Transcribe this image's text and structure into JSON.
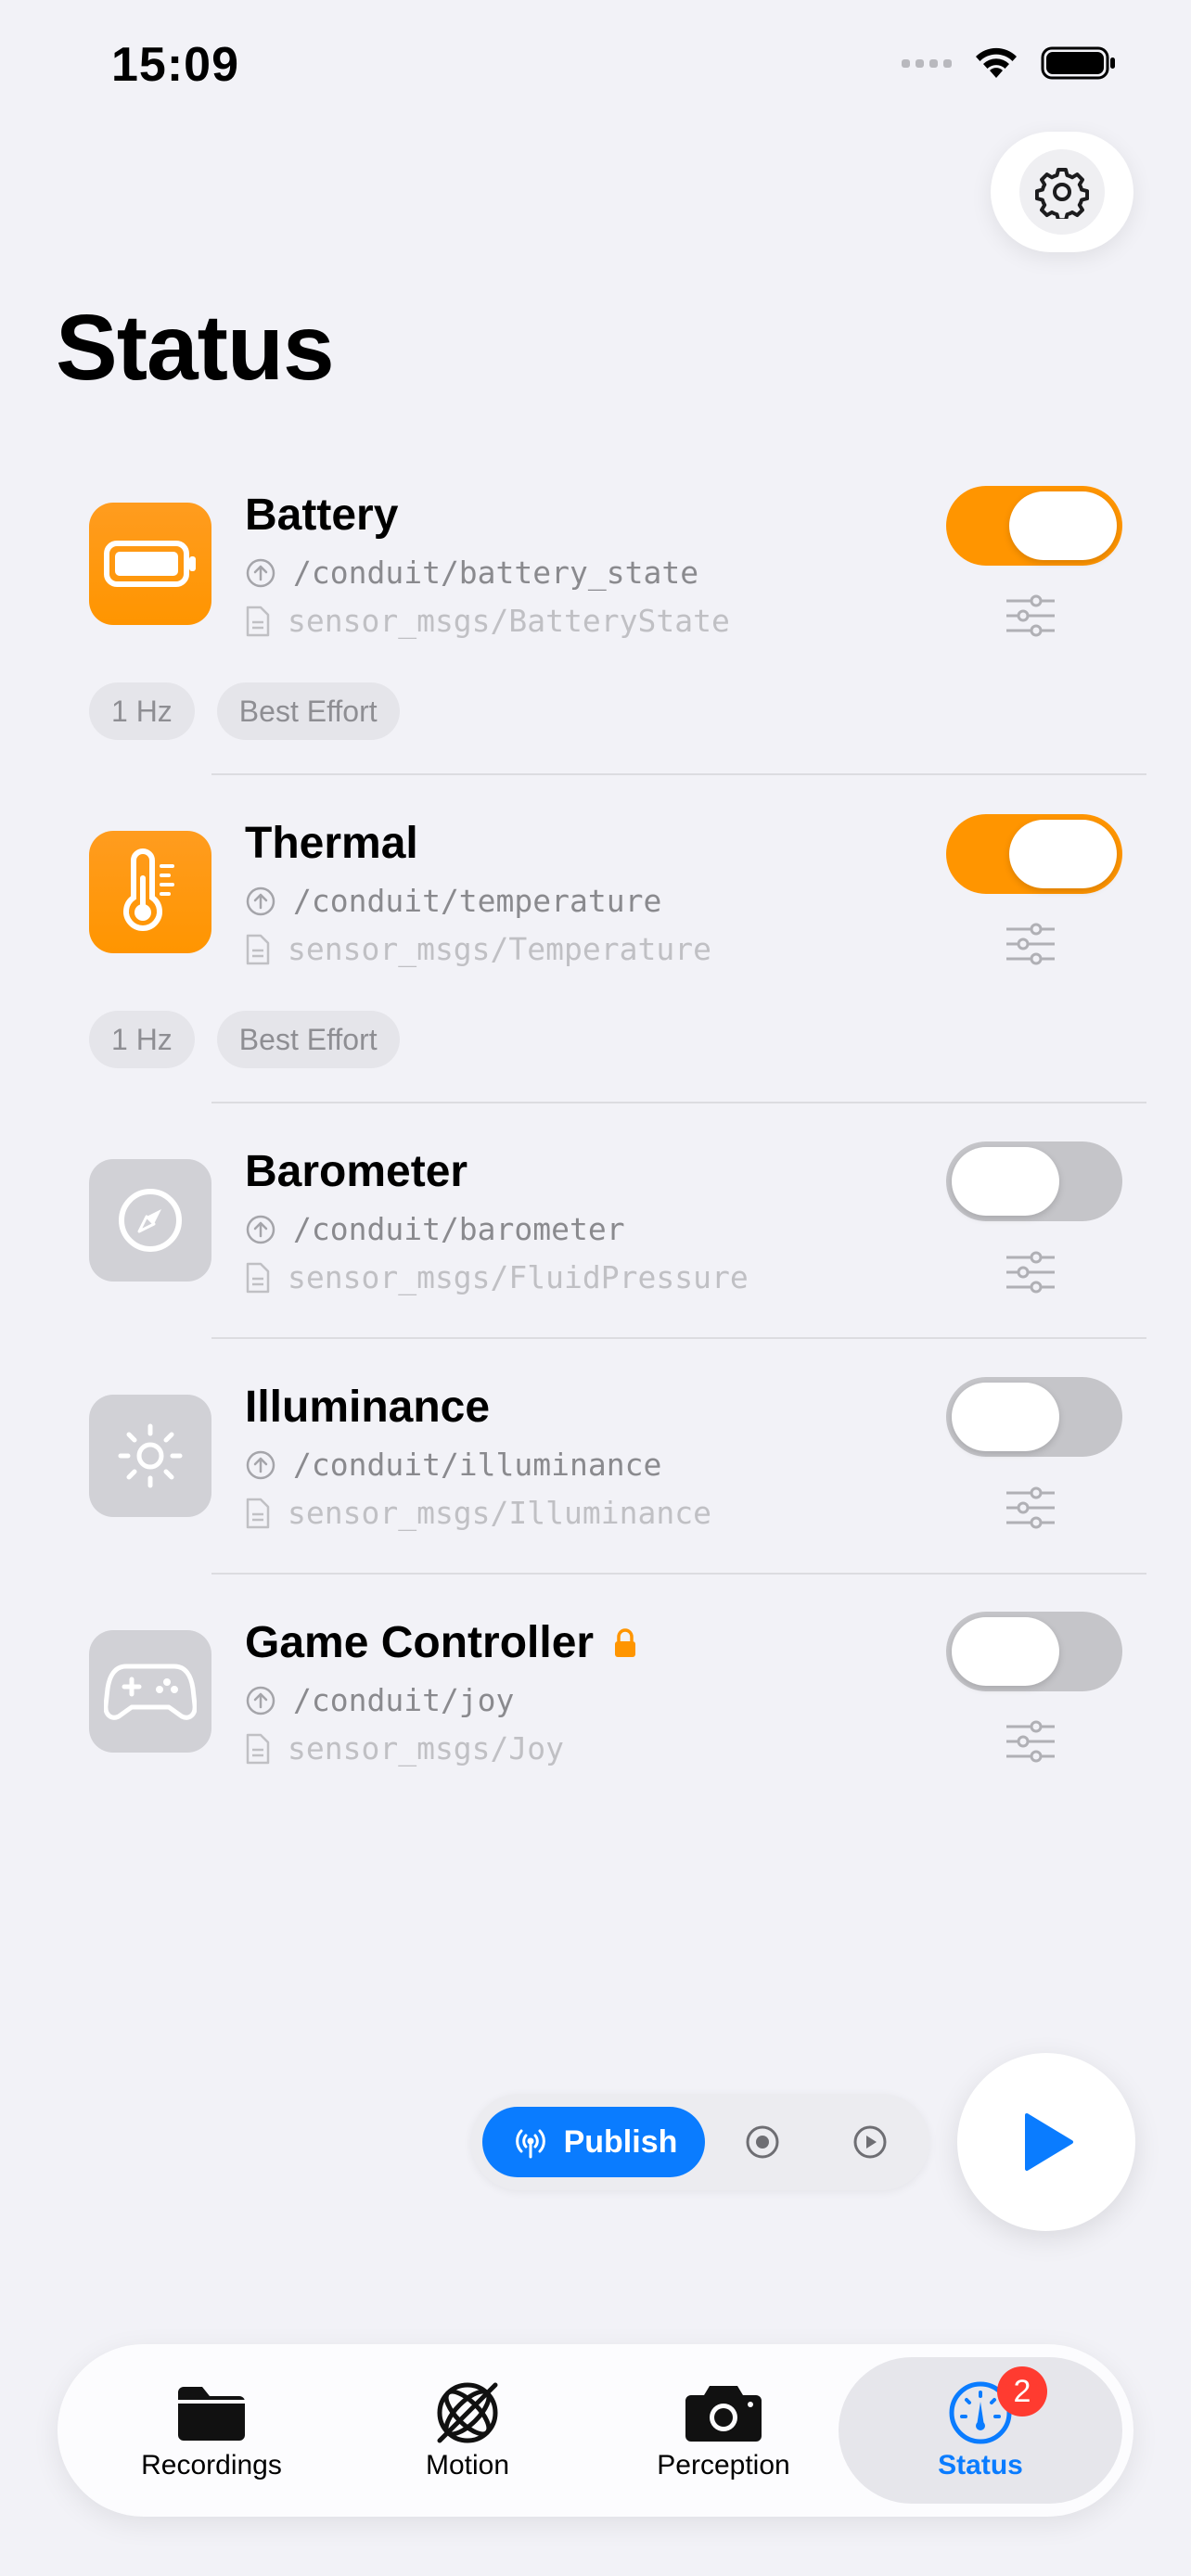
{
  "status_bar": {
    "time": "15:09"
  },
  "page": {
    "title": "Status"
  },
  "sensors": [
    {
      "name": "Battery",
      "topic": "/conduit/battery_state",
      "msg_type": "sensor_msgs/BatteryState",
      "enabled": true,
      "icon": "battery-icon",
      "chips": [
        "1 Hz",
        "Best Effort"
      ]
    },
    {
      "name": "Thermal",
      "topic": "/conduit/temperature",
      "msg_type": "sensor_msgs/Temperature",
      "enabled": true,
      "icon": "thermometer-icon",
      "chips": [
        "1 Hz",
        "Best Effort"
      ]
    },
    {
      "name": "Barometer",
      "topic": "/conduit/barometer",
      "msg_type": "sensor_msgs/FluidPressure",
      "enabled": false,
      "icon": "gauge-icon"
    },
    {
      "name": "Illuminance",
      "topic": "/conduit/illuminance",
      "msg_type": "sensor_msgs/Illuminance",
      "enabled": false,
      "icon": "sun-icon"
    },
    {
      "name": "Game Controller",
      "topic": "/conduit/joy",
      "msg_type": "sensor_msgs/Joy",
      "enabled": false,
      "icon": "gamepad-icon",
      "locked": true
    }
  ],
  "mode_bar": {
    "publish_label": "Publish",
    "selected": "publish"
  },
  "tabs": [
    {
      "label": "Recordings",
      "icon": "folder-icon"
    },
    {
      "label": "Motion",
      "icon": "gyroscope-icon"
    },
    {
      "label": "Perception",
      "icon": "camera-icon"
    },
    {
      "label": "Status",
      "icon": "gauge-icon",
      "badge": "2",
      "active": true
    }
  ],
  "colors": {
    "accent": "#0A7CFF",
    "sensor_on": "#FF9500",
    "sensor_off": "#C5C5C9",
    "badge": "#FF3B30"
  }
}
